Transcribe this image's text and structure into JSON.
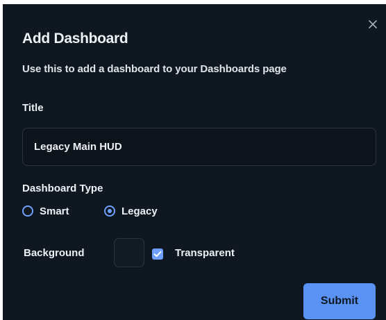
{
  "dialog": {
    "title": "Add Dashboard",
    "subtitle": "Use this to add a dashboard to your Dashboards page",
    "close_icon": "close-icon"
  },
  "form": {
    "title_label": "Title",
    "title_value": "Legacy Main HUD",
    "type_label": "Dashboard Type",
    "type_options": [
      {
        "label": "Smart",
        "selected": false
      },
      {
        "label": "Legacy",
        "selected": true
      }
    ],
    "background_label": "Background",
    "background_color": "#121b24",
    "transparent_label": "Transparent",
    "transparent_checked": true
  },
  "actions": {
    "submit_label": "Submit"
  },
  "colors": {
    "modal_bg": "#0f1720",
    "accent": "#5b93f5"
  }
}
